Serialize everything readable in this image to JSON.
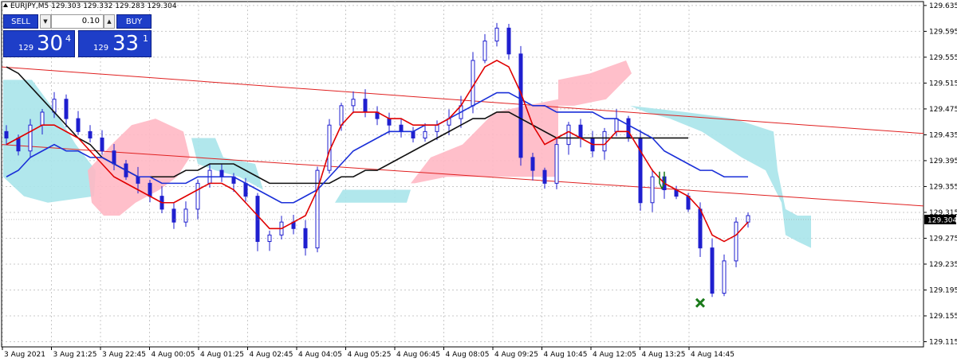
{
  "header": {
    "symbol_label": "EURJPY,M5  129.303 129.332 129.283 129.304"
  },
  "trade_panel": {
    "sell_label": "SELL",
    "buy_label": "BUY",
    "lot_value": "0.10",
    "lot_dec_glyph": "▼",
    "lot_inc_glyph": "▲",
    "sell_quote": {
      "prefix": "129",
      "big": "30",
      "sup": "4"
    },
    "buy_quote": {
      "prefix": "129",
      "big": "33",
      "sup": "1"
    }
  },
  "colors": {
    "bull": "#1f1fcf",
    "bear": "#1f1fcf",
    "grid": "#c8c8c8",
    "kumo_bull": "#a8e4ea",
    "kumo_bear": "#ffb8c4",
    "ma_fast": "#e00000",
    "ma_mid": "#1a2fd8",
    "ma_slow": "#101010",
    "trendline": "#e02020",
    "price_tag": "#000000",
    "marker": "#1a7a1a"
  },
  "chart_data": {
    "type": "candlestick",
    "symbol": "EURJPY",
    "timeframe": "M5",
    "ohlc_last": {
      "open": 129.303,
      "high": 129.332,
      "low": 129.283,
      "close": 129.304
    },
    "current_price": "129.304",
    "ylim": [
      129.107,
      129.641
    ],
    "y_ticks": [
      "129.635",
      "129.595",
      "129.555",
      "129.515",
      "129.475",
      "129.435",
      "129.395",
      "129.355",
      "129.315",
      "129.275",
      "129.235",
      "129.195",
      "129.155",
      "129.115"
    ],
    "x_ticks": [
      "3 Aug 2021",
      "3 Aug 21:25",
      "3 Aug 22:45",
      "4 Aug 00:05",
      "4 Aug 01:25",
      "4 Aug 02:45",
      "4 Aug 04:05",
      "4 Aug 05:25",
      "4 Aug 06:45",
      "4 Aug 08:05",
      "4 Aug 09:25",
      "4 Aug 10:45",
      "4 Aug 12:05",
      "4 Aug 13:25",
      "4 Aug 14:45"
    ],
    "grid": true,
    "close_path": [
      129.43,
      129.41,
      129.45,
      129.47,
      129.49,
      129.46,
      129.44,
      129.43,
      129.41,
      129.39,
      129.37,
      129.36,
      129.34,
      129.32,
      129.3,
      129.32,
      129.36,
      129.38,
      129.37,
      129.36,
      129.34,
      129.27,
      129.28,
      129.3,
      129.29,
      129.26,
      129.38,
      129.45,
      129.48,
      129.49,
      129.47,
      129.46,
      129.45,
      129.44,
      129.43,
      129.44,
      129.45,
      129.46,
      129.48,
      129.55,
      129.58,
      129.6,
      129.56,
      129.4,
      129.38,
      129.36,
      129.42,
      129.45,
      129.43,
      129.41,
      129.44,
      129.46,
      129.43,
      129.33,
      129.37,
      129.35,
      129.34,
      129.32,
      129.26,
      129.19,
      129.24,
      129.3,
      129.31
    ]
  },
  "indicators": {
    "ma_fast_values": [
      129.42,
      129.43,
      129.44,
      129.45,
      129.45,
      129.44,
      129.43,
      129.41,
      129.39,
      129.37,
      129.36,
      129.35,
      129.34,
      129.33,
      129.33,
      129.34,
      129.35,
      129.36,
      129.36,
      129.35,
      129.33,
      129.31,
      129.29,
      129.29,
      129.3,
      129.31,
      129.35,
      129.41,
      129.45,
      129.47,
      129.47,
      129.47,
      129.46,
      129.46,
      129.45,
      129.45,
      129.45,
      129.46,
      129.48,
      129.51,
      129.54,
      129.55,
      129.54,
      129.5,
      129.45,
      129.42,
      129.43,
      129.44,
      129.43,
      129.42,
      129.42,
      129.44,
      129.44,
      129.41,
      129.38,
      129.36,
      129.35,
      129.34,
      129.32,
      129.28,
      129.27,
      129.28,
      129.3
    ],
    "ma_mid_values": [
      129.37,
      129.38,
      129.4,
      129.41,
      129.42,
      129.41,
      129.41,
      129.4,
      129.4,
      129.39,
      129.38,
      129.37,
      129.37,
      129.36,
      129.36,
      129.36,
      129.37,
      129.37,
      129.37,
      129.37,
      129.36,
      129.35,
      129.34,
      129.33,
      129.33,
      129.34,
      129.35,
      129.37,
      129.39,
      129.41,
      129.42,
      129.43,
      129.44,
      129.44,
      129.44,
      129.45,
      129.45,
      129.46,
      129.47,
      129.48,
      129.49,
      129.5,
      129.5,
      129.49,
      129.48,
      129.48,
      129.47,
      129.47,
      129.47,
      129.47,
      129.46,
      129.46,
      129.45,
      129.44,
      129.43,
      129.41,
      129.4,
      129.39,
      129.38,
      129.38,
      129.37,
      129.37,
      129.37
    ],
    "ma_slow_values": [
      129.54,
      129.53,
      129.51,
      129.49,
      129.47,
      129.45,
      129.43,
      129.42,
      129.4,
      129.39,
      129.38,
      129.37,
      129.37,
      129.37,
      129.37,
      129.38,
      129.38,
      129.39,
      129.39,
      129.39,
      129.38,
      129.37,
      129.36,
      129.36,
      129.36,
      129.36,
      129.36,
      129.36,
      129.37,
      129.37,
      129.38,
      129.38,
      129.39,
      129.4,
      129.41,
      129.42,
      129.43,
      129.44,
      129.45,
      129.46,
      129.46,
      129.47,
      129.47,
      129.46,
      129.45,
      129.44,
      129.43,
      129.43,
      129.43,
      129.43,
      129.43,
      129.43,
      129.43,
      129.43,
      129.43,
      129.43,
      129.43,
      129.43,
      129.43,
      129.43,
      129.43,
      129.43,
      129.43
    ]
  }
}
